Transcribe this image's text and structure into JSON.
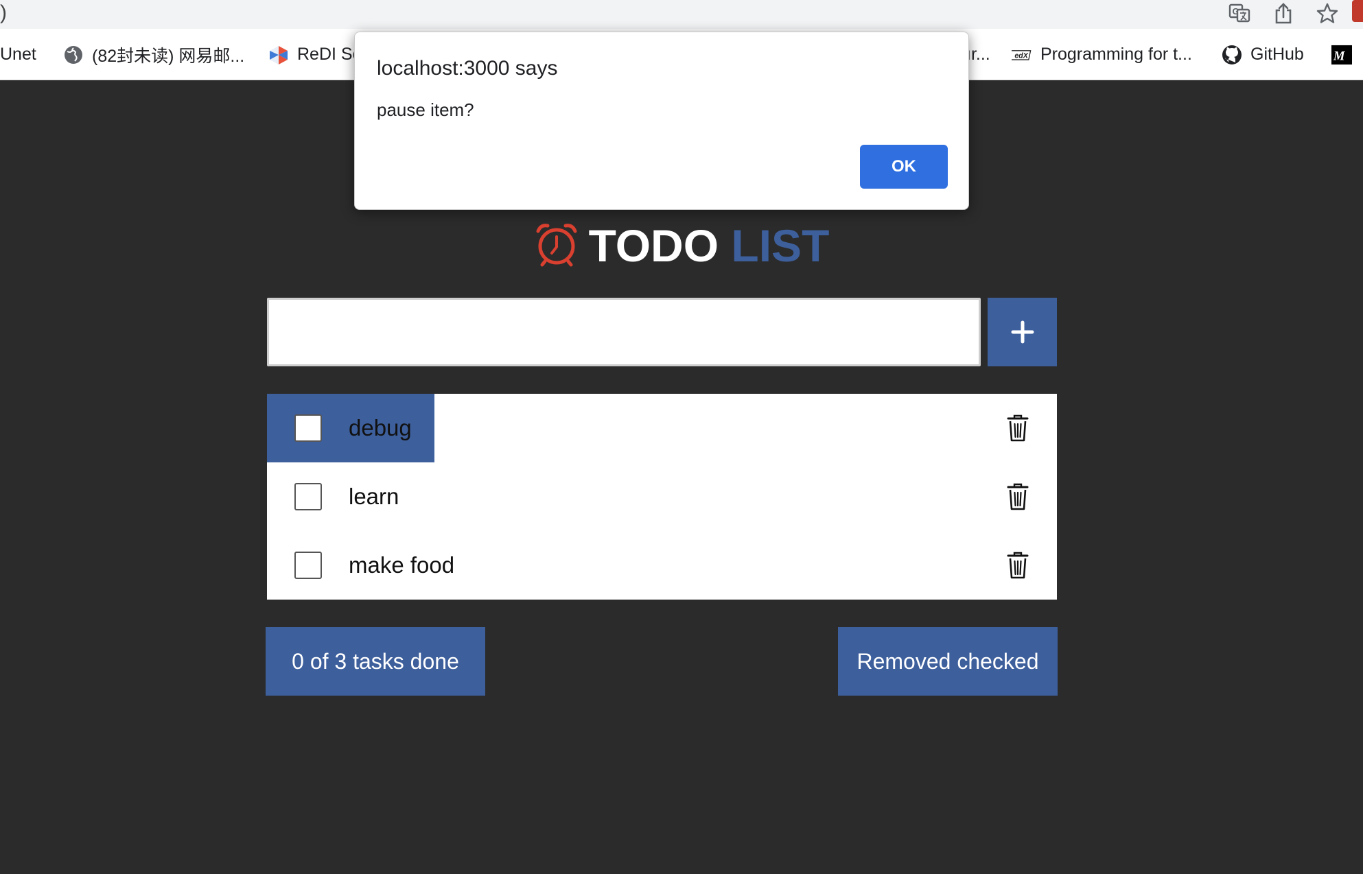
{
  "browser": {
    "top_edge_char": ")",
    "bookmarks": [
      {
        "label": "Unet",
        "icon": "none"
      },
      {
        "label": "(82封未读) 网易邮...",
        "icon": "globe-icon"
      },
      {
        "label": "ReDI Sc",
        "icon": "redi-icon"
      },
      {
        "label": "ır...",
        "icon": "none"
      },
      {
        "label": "Programming for t...",
        "icon": "edx-icon"
      },
      {
        "label": "GitHub",
        "icon": "github-icon"
      },
      {
        "label": "",
        "icon": "medium-icon"
      }
    ],
    "toolbar_icons": [
      "translate-icon",
      "share-icon",
      "star-icon"
    ]
  },
  "dialog": {
    "title": "localhost:3000 says",
    "message": "pause item?",
    "ok_label": "OK"
  },
  "app": {
    "title_main": "TODO",
    "title_accent": "LIST",
    "title_icon": "alarm-clock-icon",
    "input": {
      "value": "",
      "placeholder": ""
    },
    "add_label": "+",
    "items": [
      {
        "label": "debug",
        "checked": false,
        "highlighted": true
      },
      {
        "label": "learn",
        "checked": false,
        "highlighted": false
      },
      {
        "label": "make food",
        "checked": false,
        "highlighted": false
      }
    ],
    "status_label": "0 of 3 tasks done",
    "remove_label": "Removed checked"
  },
  "colors": {
    "background": "#2b2b2b",
    "accent": "#3d5f9c",
    "alarm_red": "#d9402f",
    "dialog_button": "#2f6fe0"
  }
}
